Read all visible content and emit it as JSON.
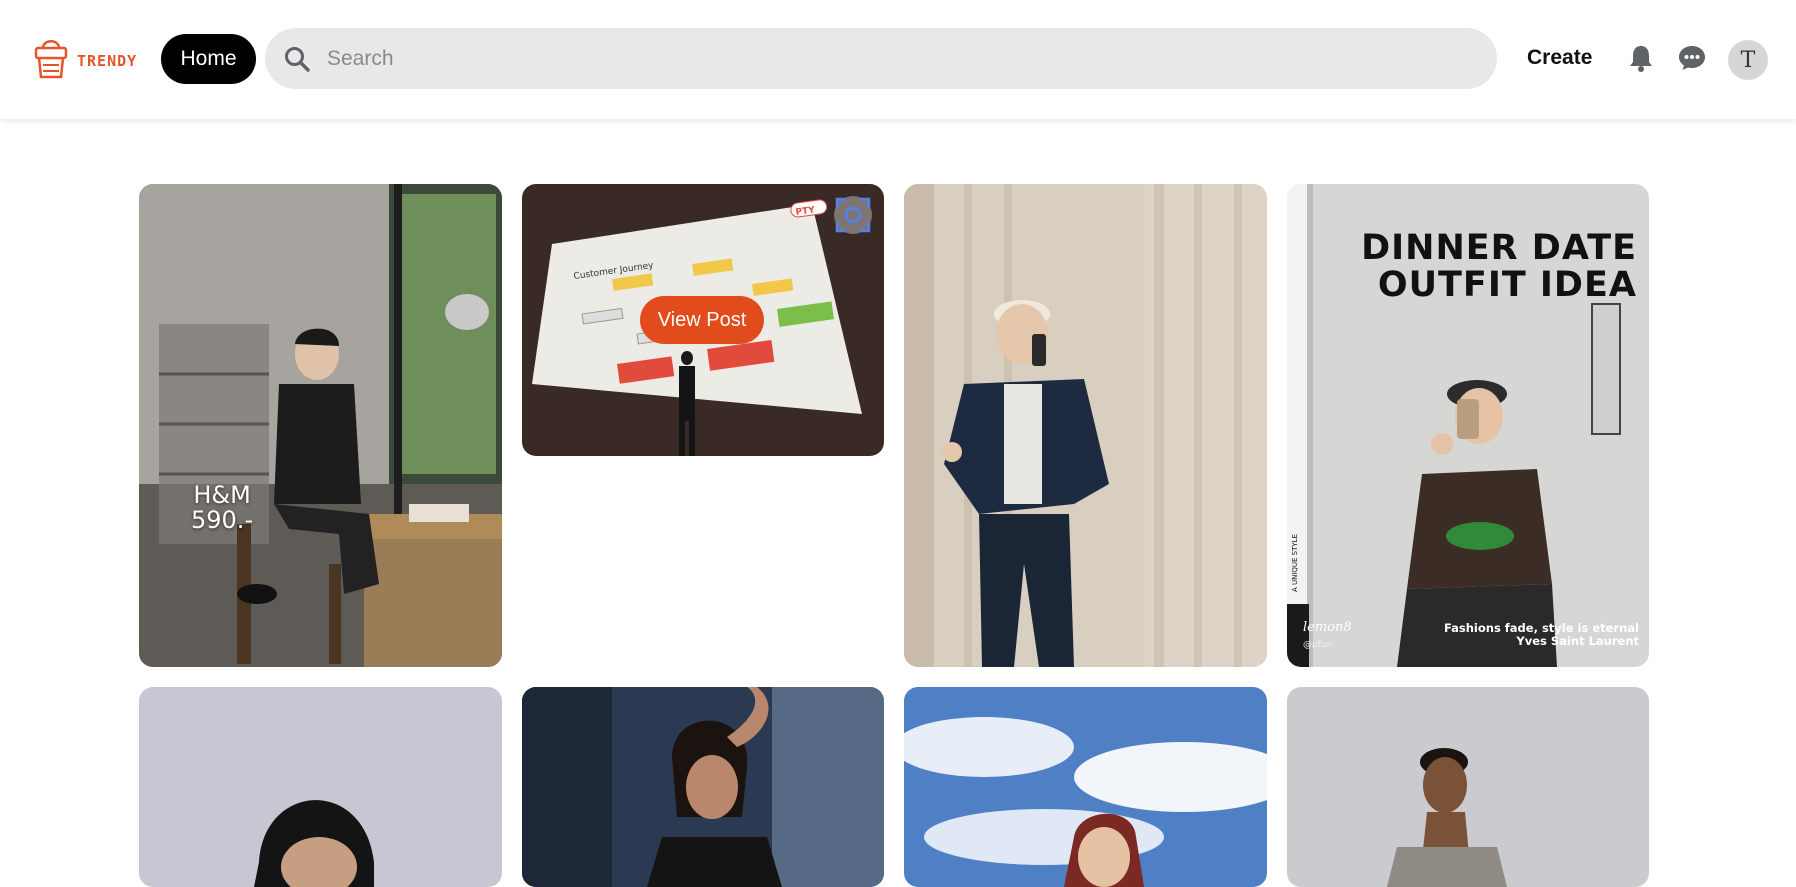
{
  "header": {
    "logo_text": "TRENDY",
    "home_label": "Home",
    "search_placeholder": "Search",
    "create_label": "Create",
    "avatar_initial": "T",
    "icons": [
      "search-icon",
      "bell-icon",
      "chat-icon"
    ]
  },
  "colors": {
    "brand": "#e8542a",
    "view_post_button": "#e24b1c",
    "home_button": "#000000",
    "search_bg": "#e8e8e8"
  },
  "posts": [
    {
      "id": "post-1",
      "overlay_lines": [
        "H&M",
        "590.-"
      ]
    },
    {
      "id": "post-2",
      "hover_button": "View Post",
      "slide_title": "Customer Journey",
      "badge": "PTY"
    },
    {
      "id": "post-3"
    },
    {
      "id": "post-4",
      "headline": [
        "DINNER DATE",
        "OUTFIT IDEA"
      ],
      "quote": [
        "Fashions fade, style is eternal",
        "Yves Saint Laurent"
      ],
      "side_text": "A UNIQUE STYLE",
      "brand_mark": "lemon8",
      "handle": "@pfun"
    },
    {
      "id": "post-5"
    },
    {
      "id": "post-6"
    },
    {
      "id": "post-7"
    },
    {
      "id": "post-8"
    }
  ]
}
